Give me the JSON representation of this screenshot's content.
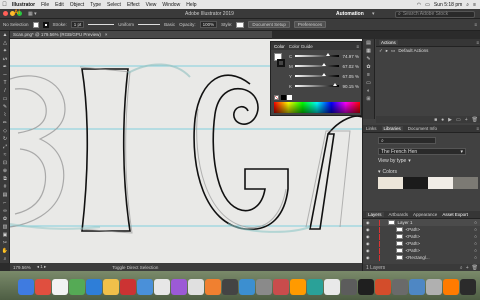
{
  "menubar": {
    "apple": "",
    "app": "Illustrator",
    "items": [
      "File",
      "Edit",
      "Object",
      "Type",
      "Select",
      "Effect",
      "View",
      "Window",
      "Help"
    ],
    "clock": "Sun 5:18 pm"
  },
  "titlebar": {
    "title": "Adobe Illustrator 2019",
    "workspace": "Automation",
    "search_placeholder": "Search Adobe Stock"
  },
  "controlbar": {
    "selection": "No Selection",
    "stroke_label": "Stroke:",
    "stroke_value": "1 pt",
    "brush_uniform": "Uniform",
    "brush_basic": "Basic",
    "opacity_label": "Opacity:",
    "opacity_value": "100%",
    "style_label": "Style:",
    "doc_setup": "Document Setup",
    "preferences": "Preferences"
  },
  "document": {
    "tab": "Scan.png* @ 179.56% (RGB/GPU Preview)",
    "close": "×"
  },
  "canvas": {
    "letters": [
      "B",
      "I",
      "G",
      "A"
    ]
  },
  "colorpanel": {
    "tabs": [
      "Color",
      "Color Guide"
    ],
    "sliders": [
      {
        "label": "C",
        "value": "74.97",
        "pos": 0.75
      },
      {
        "label": "M",
        "value": "67.02",
        "pos": 0.67
      },
      {
        "label": "Y",
        "value": "67.05",
        "pos": 0.67
      },
      {
        "label": "K",
        "value": "90.15",
        "pos": 0.9
      }
    ],
    "unit": "%"
  },
  "actions": {
    "tab": "Actions",
    "default_set": "Default Actions"
  },
  "libraries": {
    "tabs": [
      "Links",
      "Libraries",
      "Document Info"
    ],
    "library_name": "The French Hen",
    "view_by": "View by type",
    "colors_header": "Colors",
    "swatches": [
      "#ece5d9",
      "#1b1b1b",
      "#f1ede7",
      "#7c7a74"
    ]
  },
  "layers": {
    "tabs": [
      "Layers",
      "Artboards",
      "Appearance",
      "Asset Export"
    ],
    "items": [
      "Layer 1",
      "<Path>",
      "<Path>",
      "<Path>",
      "<Path>",
      "<Rectangl..."
    ],
    "footer": "1 Layers"
  },
  "statusbar": {
    "zoom": "179.56%",
    "tool": "Toggle Direct Selection"
  },
  "toolbar": {
    "tools": [
      "selection",
      "direct-selection",
      "magic-wand",
      "lasso",
      "pen",
      "curvature",
      "type",
      "line",
      "rectangle",
      "paintbrush",
      "shaper",
      "pencil",
      "eraser",
      "rotate",
      "scale",
      "width",
      "free-transform",
      "shape-builder",
      "perspective",
      "mesh",
      "gradient",
      "eyedropper",
      "blend",
      "symbol",
      "graph",
      "artboard",
      "slice",
      "hand",
      "zoom"
    ],
    "glyphs": [
      "▲",
      "△",
      "✦",
      "ᔕ",
      "✒",
      "∽",
      "T",
      "/",
      "▭",
      "✎",
      "⌇",
      "✏",
      "◇",
      "↻",
      "⤢",
      "≈",
      "⊡",
      "⊕",
      "⧉",
      "#",
      "▤",
      "⌐",
      "∞",
      "✿",
      "▥",
      "▣",
      "✂",
      "✋",
      "⌕"
    ]
  },
  "dock": {
    "colors": [
      "#3f7be0",
      "#e04f3f",
      "#f2f2f2",
      "#55aa55",
      "#2e7ed8",
      "#f0c04a",
      "#cc3333",
      "#4a90d9",
      "#e7e7e7",
      "#9c5ad6",
      "#e0e0e0",
      "#f08030",
      "#444444",
      "#3c8fd0",
      "#8a8a8a",
      "#c94c4c",
      "#ff9a00",
      "#2aa198",
      "#e9e9e9",
      "#5c5c5c",
      "#1f1f1f",
      "#d34d2b",
      "#6a6a6a",
      "#4e87c4",
      "#b0b0b0",
      "#ff7b00",
      "#2b2b2b"
    ]
  }
}
